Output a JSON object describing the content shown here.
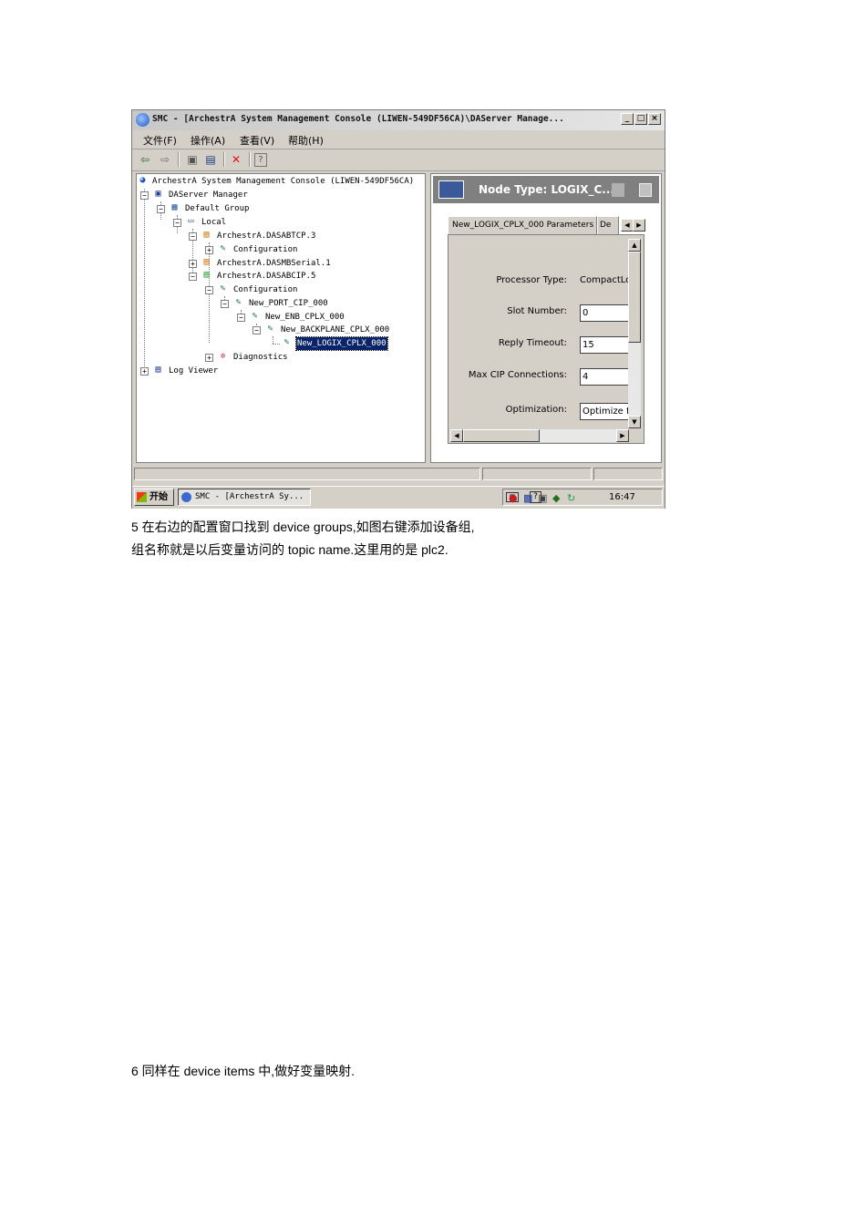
{
  "window": {
    "title": "SMC - [ArchestrA System Management Console (LIWEN-549DF56CA)\\DAServer Manage...",
    "controls": {
      "minimize": "_",
      "maximize": "□",
      "close": "×"
    }
  },
  "menu": [
    "文件(F)",
    "操作(A)",
    "查看(V)",
    "帮助(H)"
  ],
  "toolbar": [
    {
      "icon": "back-arrow-icon",
      "glyph": "⇦"
    },
    {
      "icon": "forward-arrow-icon",
      "glyph": "⇨"
    },
    {
      "icon": "up-folder-icon",
      "glyph": "▣"
    },
    {
      "icon": "show-hide-tree-icon",
      "glyph": "▤"
    },
    {
      "icon": "delete-icon",
      "glyph": "✕"
    },
    {
      "icon": "properties-icon",
      "glyph": "?"
    }
  ],
  "tree": [
    {
      "label": "ArchestrA System Management Console (LIWEN-549DF56CA)",
      "level": 0,
      "icon": "smc-globe-icon",
      "expander": ""
    },
    {
      "label": "DAServer Manager",
      "level": 1,
      "icon": "server-manager-icon",
      "expander": "−"
    },
    {
      "label": "Default Group",
      "level": 2,
      "icon": "group-icon",
      "expander": "−"
    },
    {
      "label": "Local",
      "level": 3,
      "icon": "computer-icon",
      "expander": "−"
    },
    {
      "label": "ArchestrA.DASABTCP.3",
      "level": 4,
      "icon": "daserver-icon",
      "expander": "−"
    },
    {
      "label": "Configuration",
      "level": 5,
      "icon": "configuration-icon",
      "expander": "+"
    },
    {
      "label": "ArchestrA.DASMBSerial.1",
      "level": 4,
      "icon": "daserver-icon",
      "expander": "+"
    },
    {
      "label": "ArchestrA.DASABCIP.5",
      "level": 4,
      "icon": "daserver-running-icon",
      "expander": "−"
    },
    {
      "label": "Configuration",
      "level": 5,
      "icon": "configuration-icon",
      "expander": "−"
    },
    {
      "label": "New_PORT_CIP_000",
      "level": 6,
      "icon": "port-icon",
      "expander": "−"
    },
    {
      "label": "New_ENB_CPLX_000",
      "level": 7,
      "icon": "enb-icon",
      "expander": "−"
    },
    {
      "label": "New_BACKPLANE_CPLX_000",
      "level": 8,
      "icon": "backplane-icon",
      "expander": "−"
    },
    {
      "label": "New_LOGIX_CPLX_000",
      "level": 9,
      "icon": "logix-icon",
      "expander": "",
      "selected": true
    },
    {
      "label": "Diagnostics",
      "level": 5,
      "icon": "diagnostics-icon",
      "expander": "+"
    },
    {
      "label": "Log Viewer",
      "level": 0,
      "icon": "log-viewer-icon",
      "expander": "+"
    }
  ],
  "right": {
    "header": "Node Type: LOGIX_C...",
    "tabs": [
      "New_LOGIX_CPLX_000 Parameters",
      "De"
    ],
    "fields": [
      {
        "label": "Processor Type:",
        "value": "CompactLog",
        "boxed": false
      },
      {
        "label": "Slot Number:",
        "value": "0",
        "boxed": true
      },
      {
        "label": "Reply Timeout:",
        "value": "15",
        "boxed": true
      },
      {
        "label": "Max CIP Connections:",
        "value": "4",
        "boxed": true
      },
      {
        "label": "Optimization:",
        "value": "Optimize for",
        "boxed": true
      }
    ]
  },
  "taskbar": {
    "start": "开始",
    "task": "SMC - [ArchestrA Sy...",
    "clock": "16:47"
  },
  "doc": {
    "line1": "5 在右边的配置窗口找到 device groups,如图右键添加设备组,",
    "line2": "组名称就是以后变量访问的 topic name.这里用的是 plc2.",
    "line3": "6 同样在 device items 中,做好变量映射."
  }
}
